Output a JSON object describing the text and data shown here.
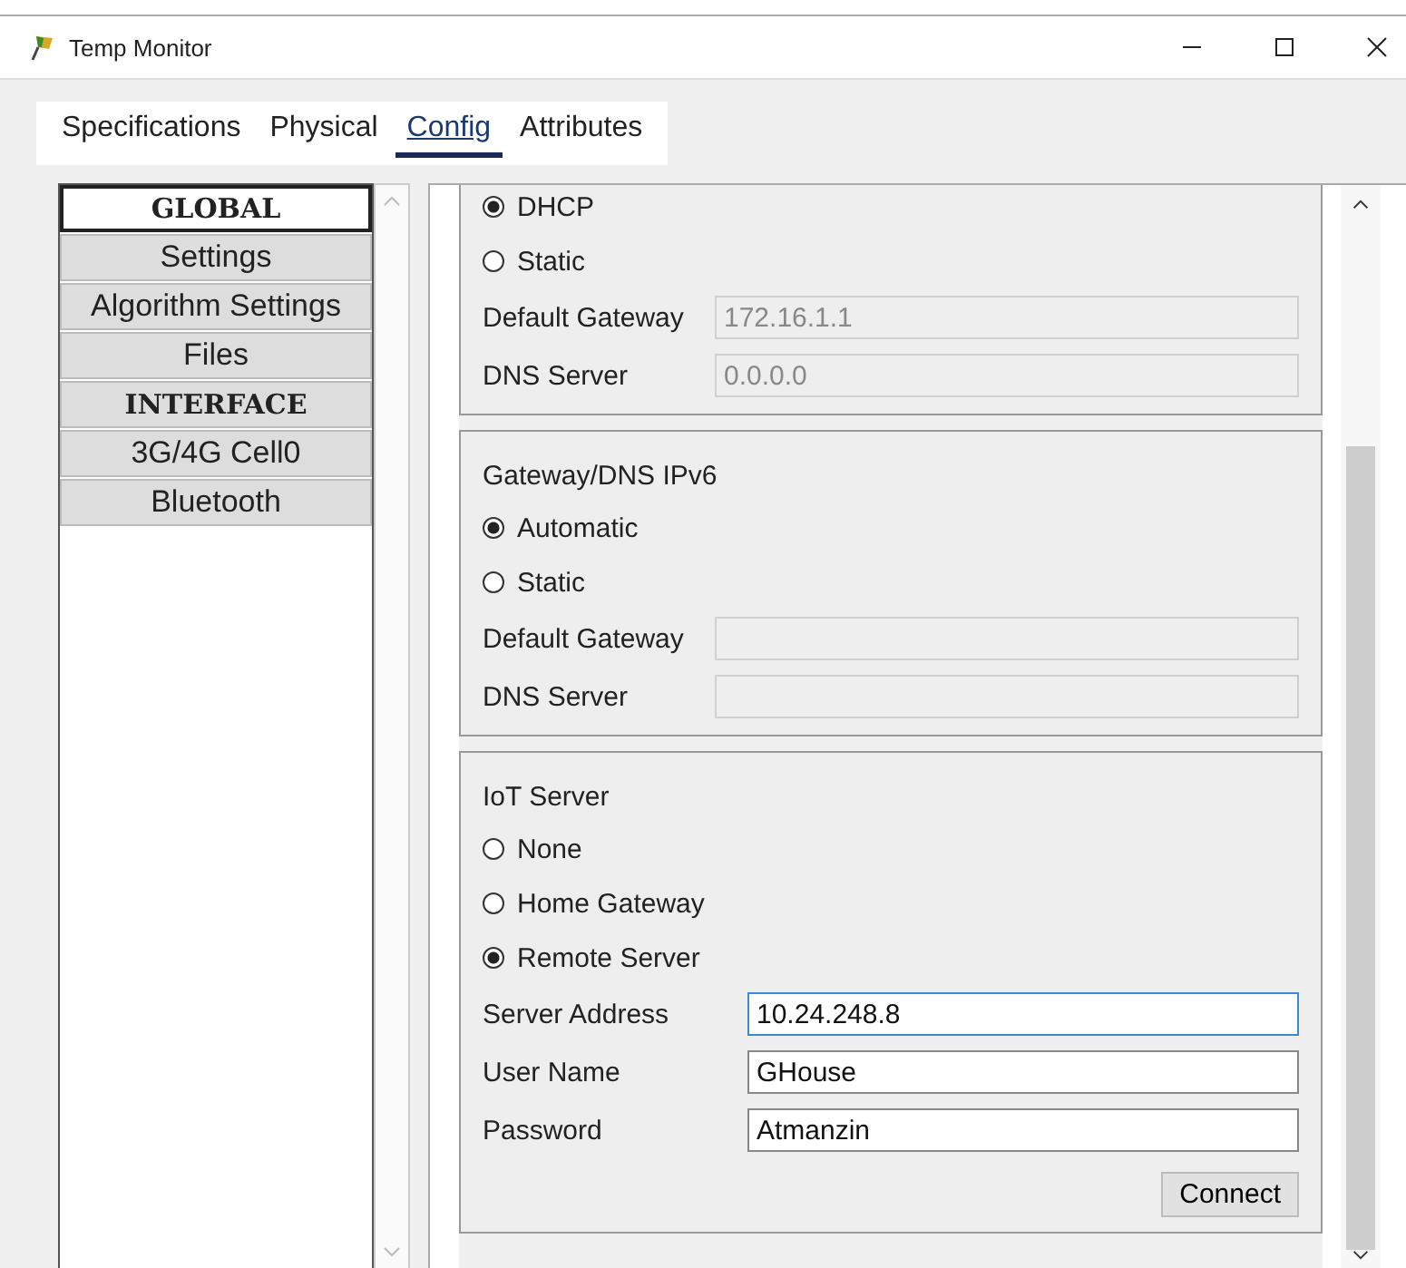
{
  "window": {
    "title": "Temp Monitor"
  },
  "tabs": [
    {
      "label": "Specifications",
      "selected": false
    },
    {
      "label": "Physical",
      "selected": false
    },
    {
      "label": "Config",
      "selected": true
    },
    {
      "label": "Attributes",
      "selected": false
    }
  ],
  "sidebar": {
    "items": [
      {
        "label": "GLOBAL",
        "kind": "heading",
        "selected": true
      },
      {
        "label": "Settings",
        "kind": "item",
        "selected": false
      },
      {
        "label": "Algorithm Settings",
        "kind": "item",
        "selected": false
      },
      {
        "label": "Files",
        "kind": "item",
        "selected": false
      },
      {
        "label": "INTERFACE",
        "kind": "heading",
        "selected": false
      },
      {
        "label": "3G/4G Cell0",
        "kind": "item",
        "selected": false
      },
      {
        "label": "Bluetooth",
        "kind": "item",
        "selected": false
      }
    ]
  },
  "sections": [
    {
      "rows": [
        {
          "kind": "radio",
          "label": "DHCP",
          "selected": true
        },
        {
          "kind": "radio",
          "label": "Static",
          "selected": false
        },
        {
          "kind": "field",
          "label": "Default Gateway",
          "value": "172.16.1.1",
          "disabled": true,
          "focused": false
        },
        {
          "kind": "field",
          "label": "DNS Server",
          "value": "0.0.0.0",
          "disabled": true,
          "focused": false
        }
      ]
    },
    {
      "title": "Gateway/DNS IPv6",
      "rows": [
        {
          "kind": "radio",
          "label": "Automatic",
          "selected": true
        },
        {
          "kind": "radio",
          "label": "Static",
          "selected": false
        },
        {
          "kind": "field",
          "label": "Default Gateway",
          "disabled": true,
          "focused": false
        },
        {
          "kind": "field",
          "label": "DNS Server",
          "disabled": true,
          "focused": false
        }
      ]
    },
    {
      "title": "IoT Server",
      "rows": [
        {
          "kind": "radio",
          "label": "None",
          "selected": false
        },
        {
          "kind": "radio",
          "label": "Home Gateway",
          "selected": false
        },
        {
          "kind": "radio",
          "label": "Remote Server",
          "selected": true
        },
        {
          "kind": "field",
          "label": "Server Address",
          "value": "10.24.248.8",
          "disabled": false,
          "focused": true
        },
        {
          "kind": "field",
          "label": "User Name",
          "value": "GHouse",
          "disabled": false,
          "focused": false
        },
        {
          "kind": "field",
          "label": "Password",
          "value": "Atmanzin",
          "disabled": false,
          "focused": false
        },
        {
          "kind": "button",
          "label": "Connect"
        }
      ]
    }
  ]
}
